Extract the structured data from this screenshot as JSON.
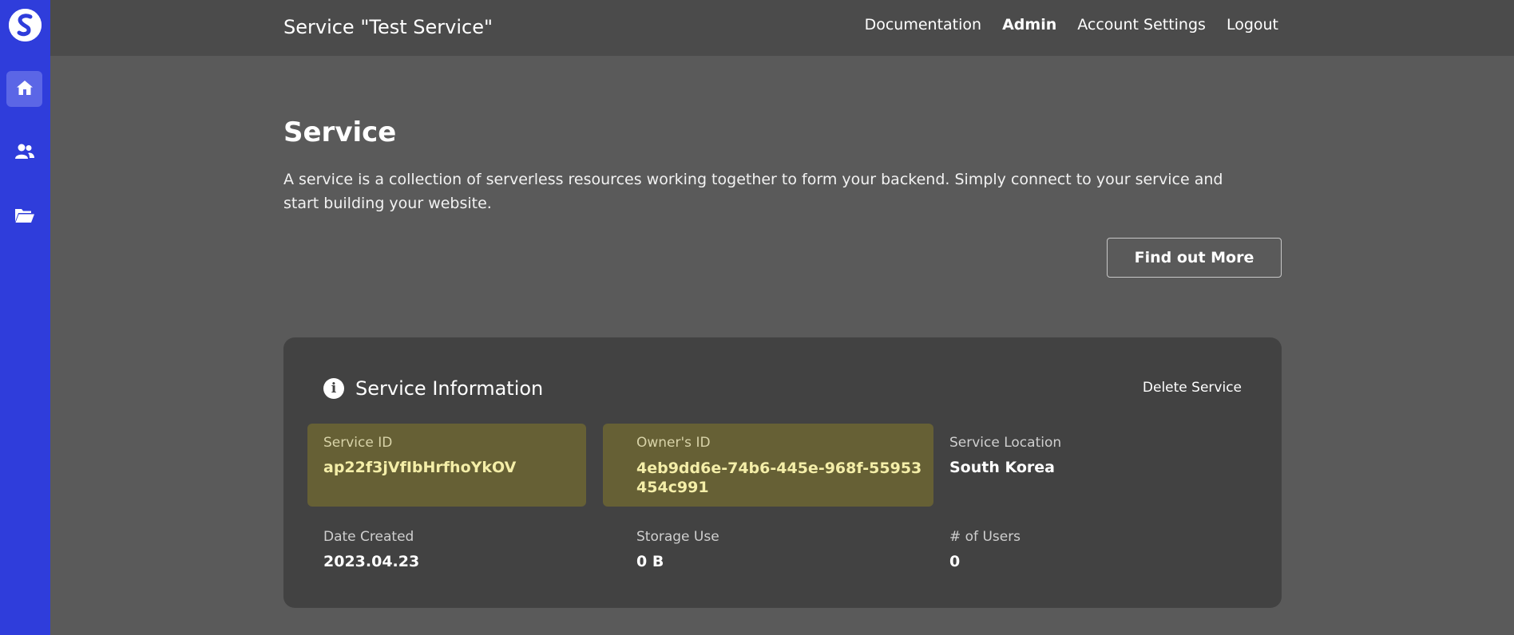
{
  "app": {
    "title": "Service \"Test Service\""
  },
  "sidebar": {
    "logo_icon": "app-logo-icon",
    "items": [
      {
        "icon": "home-icon",
        "active": true
      },
      {
        "icon": "users-icon",
        "active": false
      },
      {
        "icon": "folder-open-icon",
        "active": false
      }
    ],
    "accent_color": "#2f3ddb"
  },
  "topnav": {
    "items": [
      {
        "label": "Documentation"
      },
      {
        "label": "Admin"
      },
      {
        "label": "Account Settings"
      },
      {
        "label": "Logout"
      }
    ]
  },
  "main": {
    "heading": "Service",
    "description": "A service is a collection of serverless resources working together to form your backend. Simply connect to your service and start building your website.",
    "find_out_more_label": "Find out More"
  },
  "service_info": {
    "title": "Service Information",
    "delete_label": "Delete Service",
    "fields": {
      "service_id": {
        "label": "Service ID",
        "value": "ap22f3jVfIbHrfhoYkOV"
      },
      "owner_id": {
        "label": "Owner's ID",
        "value": "4eb9dd6e-74b6-445e-968f-55953454c991"
      },
      "location": {
        "label": "Service Location",
        "value": "South Korea"
      },
      "date_created": {
        "label": "Date Created",
        "value": "2023.04.23"
      },
      "storage_use": {
        "label": "Storage Use",
        "value": "0 B"
      },
      "users": {
        "label": "# of Users",
        "value": "0"
      }
    },
    "highlight_color": "#666035"
  }
}
